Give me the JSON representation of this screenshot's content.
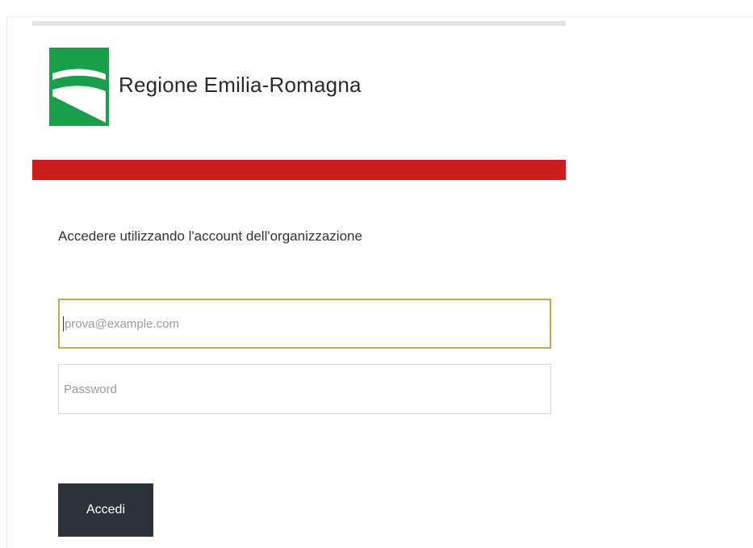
{
  "brand": {
    "name": "Regione Emilia-Romagna",
    "logo": "regione-emilia-romagna-logo",
    "logo_color": "#1a9f4a",
    "band_color": "#cc1d1d"
  },
  "login": {
    "intro": "Accedere utilizzando l'account dell'organizzazione",
    "email_placeholder": "prova@example.com",
    "email_value": "",
    "password_placeholder": "Password",
    "password_value": "",
    "submit_label": "Accedi",
    "focus_color": "#c9a84b",
    "button_color": "#2c313a"
  }
}
